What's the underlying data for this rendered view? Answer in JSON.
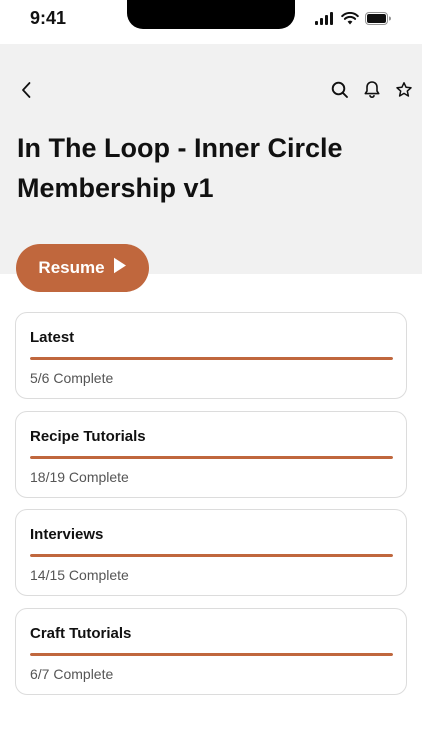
{
  "status_bar": {
    "time": "9:41"
  },
  "header": {
    "title": "In The Loop - Inner Circle Membership v1"
  },
  "resume": {
    "label": "Resume"
  },
  "sections": [
    {
      "title": "Latest",
      "status": "5/6 Complete",
      "progress": 1.0
    },
    {
      "title": "Recipe Tutorials",
      "status": "18/19 Complete",
      "progress": 1.0
    },
    {
      "title": "Interviews",
      "status": "14/15 Complete",
      "progress": 1.0
    },
    {
      "title": "Craft Tutorials",
      "status": "6/7 Complete",
      "progress": 1.0
    }
  ],
  "icons": {
    "back": "chevron-left-icon",
    "search": "search-icon",
    "notifications": "bell-icon",
    "favorite": "star-icon",
    "play": "play-icon"
  },
  "colors": {
    "accent": "#c0673d",
    "hero_bg": "#f1f1f1"
  }
}
